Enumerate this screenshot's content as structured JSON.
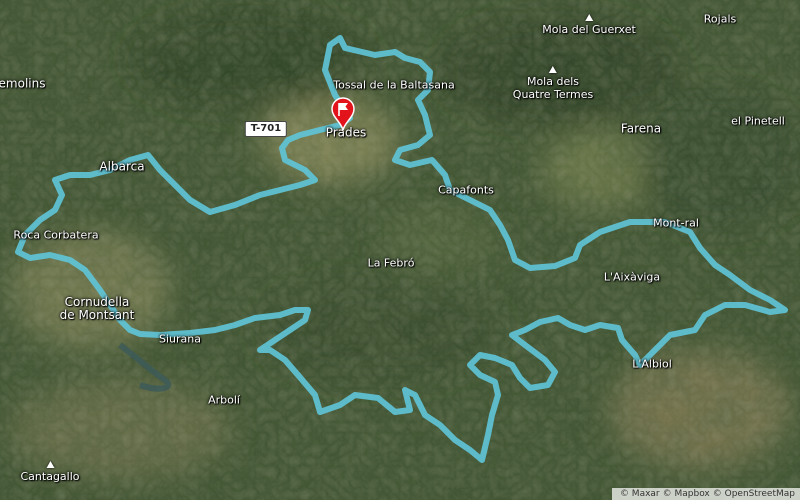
{
  "map": {
    "style": "satellite",
    "route_color": "#5fc3d6",
    "marker_color": "#e3131b",
    "road_label": "T-701",
    "places": [
      {
        "key": "ulldemolins",
        "name": "emolins"
      },
      {
        "key": "albarca",
        "name": "Albarca"
      },
      {
        "key": "roca-corbatera",
        "name": "Roca Corbatera"
      },
      {
        "key": "cornudella",
        "name": "Cornudella\nde Montsant"
      },
      {
        "key": "siurana",
        "name": "Siurana"
      },
      {
        "key": "arboli",
        "name": "Arbolí"
      },
      {
        "key": "prades",
        "name": "Prades"
      },
      {
        "key": "capafonts",
        "name": "Capafonts"
      },
      {
        "key": "la-febro",
        "name": "La Febró"
      },
      {
        "key": "farena",
        "name": "Farena"
      },
      {
        "key": "el-pinetell",
        "name": "el Pinetell"
      },
      {
        "key": "mont-ral",
        "name": "Mont-ral"
      },
      {
        "key": "aixaviga",
        "name": "L'Aixàviga"
      },
      {
        "key": "albiol",
        "name": "L'Albiol"
      },
      {
        "key": "rojals",
        "name": "Rojals"
      },
      {
        "key": "tossal-baltasana",
        "name": "Tossal de la Baltasana"
      }
    ],
    "peaks": [
      {
        "key": "mola-guerxet",
        "name": "Mola del Guerxet",
        "icon": "peak-triangle-icon"
      },
      {
        "key": "mola-quatre-termes",
        "name": "Mola dels\nQuatre Termes",
        "icon": "peak-triangle-icon"
      },
      {
        "key": "cantagallo",
        "name": "Cantagallo",
        "icon": "peak-triangle-icon"
      }
    ],
    "start_marker_icon": "flag-pin-icon",
    "attribution": [
      "© Maxar",
      "© Mapbox",
      "© OpenStreetMap"
    ]
  }
}
